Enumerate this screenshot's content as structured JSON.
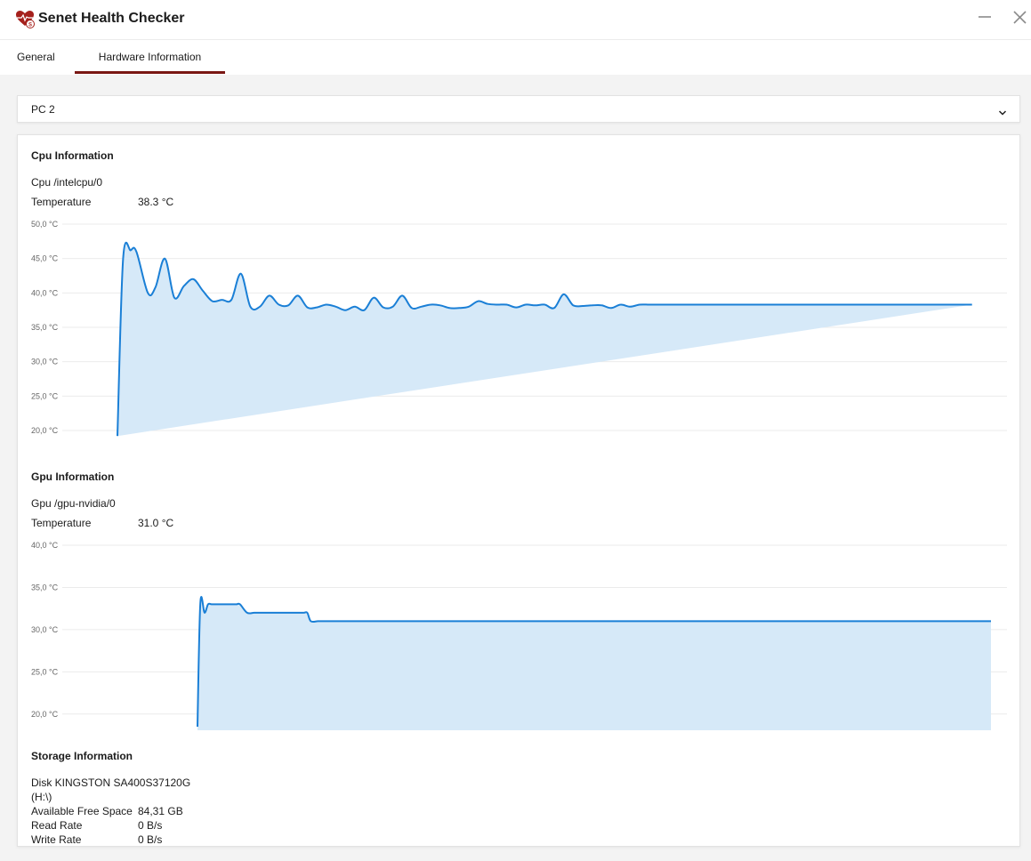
{
  "app": {
    "title": "Senet Health Checker"
  },
  "tabs": [
    {
      "label": "General",
      "active": false
    },
    {
      "label": "Hardware Information",
      "active": true
    }
  ],
  "accent_color": "#7a1713",
  "chart_line_color": "#1a7fd6",
  "chart_fill_color": "#d6e9f8",
  "pc_select": {
    "value": "PC 2"
  },
  "cpu": {
    "section_title": "Cpu Information",
    "device": "Cpu /intelcpu/0",
    "temperature_label": "Temperature",
    "temperature_value": "38.3 °C"
  },
  "gpu": {
    "section_title": "Gpu Information",
    "device": "Gpu /gpu-nvidia/0",
    "temperature_label": "Temperature",
    "temperature_value": "31.0 °C"
  },
  "storage": {
    "section_title": "Storage Information",
    "disk_line1": "Disk KINGSTON SA400S37120G",
    "disk_line2": "(H:\\)",
    "free_space_label": "Available Free Space",
    "free_space_value": "84,31 GB",
    "read_rate_label": "Read Rate",
    "read_rate_value": "0 B/s",
    "write_rate_label": "Write Rate",
    "write_rate_value": "0 B/s"
  },
  "chart_data": [
    {
      "type": "area",
      "ylim": [
        20,
        50
      ],
      "ytick_values": [
        20,
        25,
        30,
        35,
        40,
        45,
        50
      ],
      "ytick_labels": [
        "20,0 °C",
        "25,0 °C",
        "30,0 °C",
        "35,0 °C",
        "40,0 °C",
        "45,0 °C",
        "50,0 °C"
      ],
      "grid": true,
      "x": [
        0,
        0.3,
        0.7,
        1,
        1.6,
        2,
        2.5,
        3,
        3.5,
        4,
        4.5,
        5,
        5.5,
        6,
        6.5,
        7,
        7.5,
        8,
        8.5,
        9,
        9.5,
        10,
        10.5,
        11,
        11.5,
        12,
        12.5,
        13,
        13.5,
        14,
        14.5,
        15,
        15.5,
        16,
        16.5,
        17,
        17.5,
        18,
        18.5,
        19,
        19.5,
        20,
        20.5,
        21,
        21.5,
        22,
        22.5,
        23,
        23.5,
        24,
        24.5,
        25,
        25.5,
        26,
        26.5,
        27,
        27.5,
        28,
        28.5,
        29,
        29.5,
        30,
        30.5,
        31,
        31.5,
        32,
        32.5,
        33,
        33.5,
        34,
        34.5,
        35,
        35.5,
        36,
        36.5,
        37,
        37.5,
        38,
        38.5,
        39,
        39.5,
        40,
        40.5,
        41,
        41.5,
        42,
        42.5,
        43,
        43.5,
        44,
        44.5,
        45,
        45.5,
        46
      ],
      "values": [
        19.2,
        45,
        46.2,
        46,
        40,
        40.8,
        45,
        39.3,
        41,
        42,
        40.3,
        38.8,
        39,
        39,
        42.8,
        38,
        38,
        39.6,
        38.3,
        38.2,
        39.6,
        37.9,
        37.9,
        38.3,
        38,
        37.5,
        38,
        37.5,
        39.3,
        37.9,
        38,
        39.6,
        37.8,
        38,
        38.3,
        38.2,
        37.8,
        37.8,
        38,
        38.8,
        38.4,
        38.3,
        38.3,
        37.9,
        38.3,
        38.2,
        38.3,
        37.8,
        39.8,
        38.2,
        38.1,
        38.2,
        38.2,
        37.8,
        38.3,
        38,
        38.3,
        38.3,
        38.3,
        38.3,
        38.3,
        38.3,
        38.3,
        38.3,
        38.3,
        38.3,
        38.3,
        38.3,
        38.3,
        38.3,
        38.3,
        38.3,
        38.3,
        38.3,
        38.3,
        38.3,
        38.3,
        38.3,
        38.3,
        38.3,
        38.3,
        38.3,
        38.3,
        38.3,
        38.3,
        38.3,
        38.3,
        38.3,
        38.3,
        38.3,
        38.3,
        38.3,
        38.3
      ]
    },
    {
      "type": "area",
      "ylim": [
        18.5,
        40
      ],
      "ytick_values": [
        20,
        25,
        30,
        35,
        40
      ],
      "ytick_labels": [
        "20,0 °C",
        "25,0 °C",
        "30,0 °C",
        "35,0 °C",
        "40,0 °C"
      ],
      "grid": true,
      "x": [
        0,
        0.4,
        1,
        1.5,
        2,
        3,
        4,
        5,
        5.5,
        6,
        7,
        8,
        9,
        10,
        11,
        12,
        13,
        14,
        15,
        15.5,
        16,
        17,
        18,
        19,
        20,
        22,
        24,
        26,
        28,
        30,
        32,
        34,
        36,
        38,
        40,
        42,
        44,
        46,
        48,
        50,
        52,
        54,
        56,
        58,
        60,
        62,
        64,
        66,
        68,
        70,
        72,
        74,
        76,
        78,
        80,
        82,
        84,
        86,
        88,
        90,
        92,
        94,
        96,
        98,
        100,
        102,
        104,
        106,
        108,
        110,
        112
      ],
      "values": [
        18.5,
        33.1,
        32,
        33,
        33,
        33,
        33,
        33,
        33,
        33,
        32,
        32,
        32,
        32,
        32,
        32,
        32,
        32,
        32,
        32,
        31,
        31,
        31,
        31,
        31,
        31,
        31,
        31,
        31,
        31,
        31,
        31,
        31,
        31,
        31,
        31,
        31,
        31,
        31,
        31,
        31,
        31,
        31,
        31,
        31,
        31,
        31,
        31,
        31,
        31,
        31,
        31,
        31,
        31,
        31,
        31,
        31,
        31,
        31,
        31,
        31,
        31,
        31,
        31,
        31,
        31,
        31,
        31,
        31,
        31,
        31
      ]
    }
  ]
}
